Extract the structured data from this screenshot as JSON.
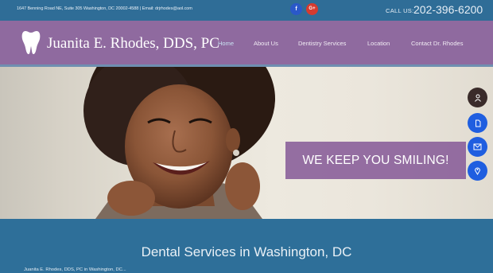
{
  "topbar": {
    "address": "1647 Benning Road NE, Suite 305 Washington, DC 20002-4588 | Email: drjrhodes@aol.com",
    "facebook_glyph": "f",
    "googleplus_glyph": "G+",
    "call_label": "CALL US:",
    "phone": "202-396-6200"
  },
  "header": {
    "brand": "Juanita E. Rhodes, DDS, PC",
    "nav": [
      "Home",
      "About Us",
      "Dentistry Services",
      "Location",
      "Contact Dr. Rhodes"
    ],
    "active_nav": "Home"
  },
  "hero": {
    "slogan": "WE KEEP YOU SMILING!"
  },
  "float_buttons": [
    "user-icon",
    "document-icon",
    "envelope-icon",
    "map-pin-icon"
  ],
  "services": {
    "title": "Dental Services in Washington, DC",
    "intro": "Juanita E. Rhodes, DDS, PC in Washington, DC..."
  },
  "colors": {
    "topbar": "#2f6d97",
    "header": "#8f6a9f",
    "slogan_box": "#875c99",
    "services_bg": "#2e6f99",
    "float_dark": "#3a2b2a",
    "float_blue": "#1f5ee0"
  }
}
